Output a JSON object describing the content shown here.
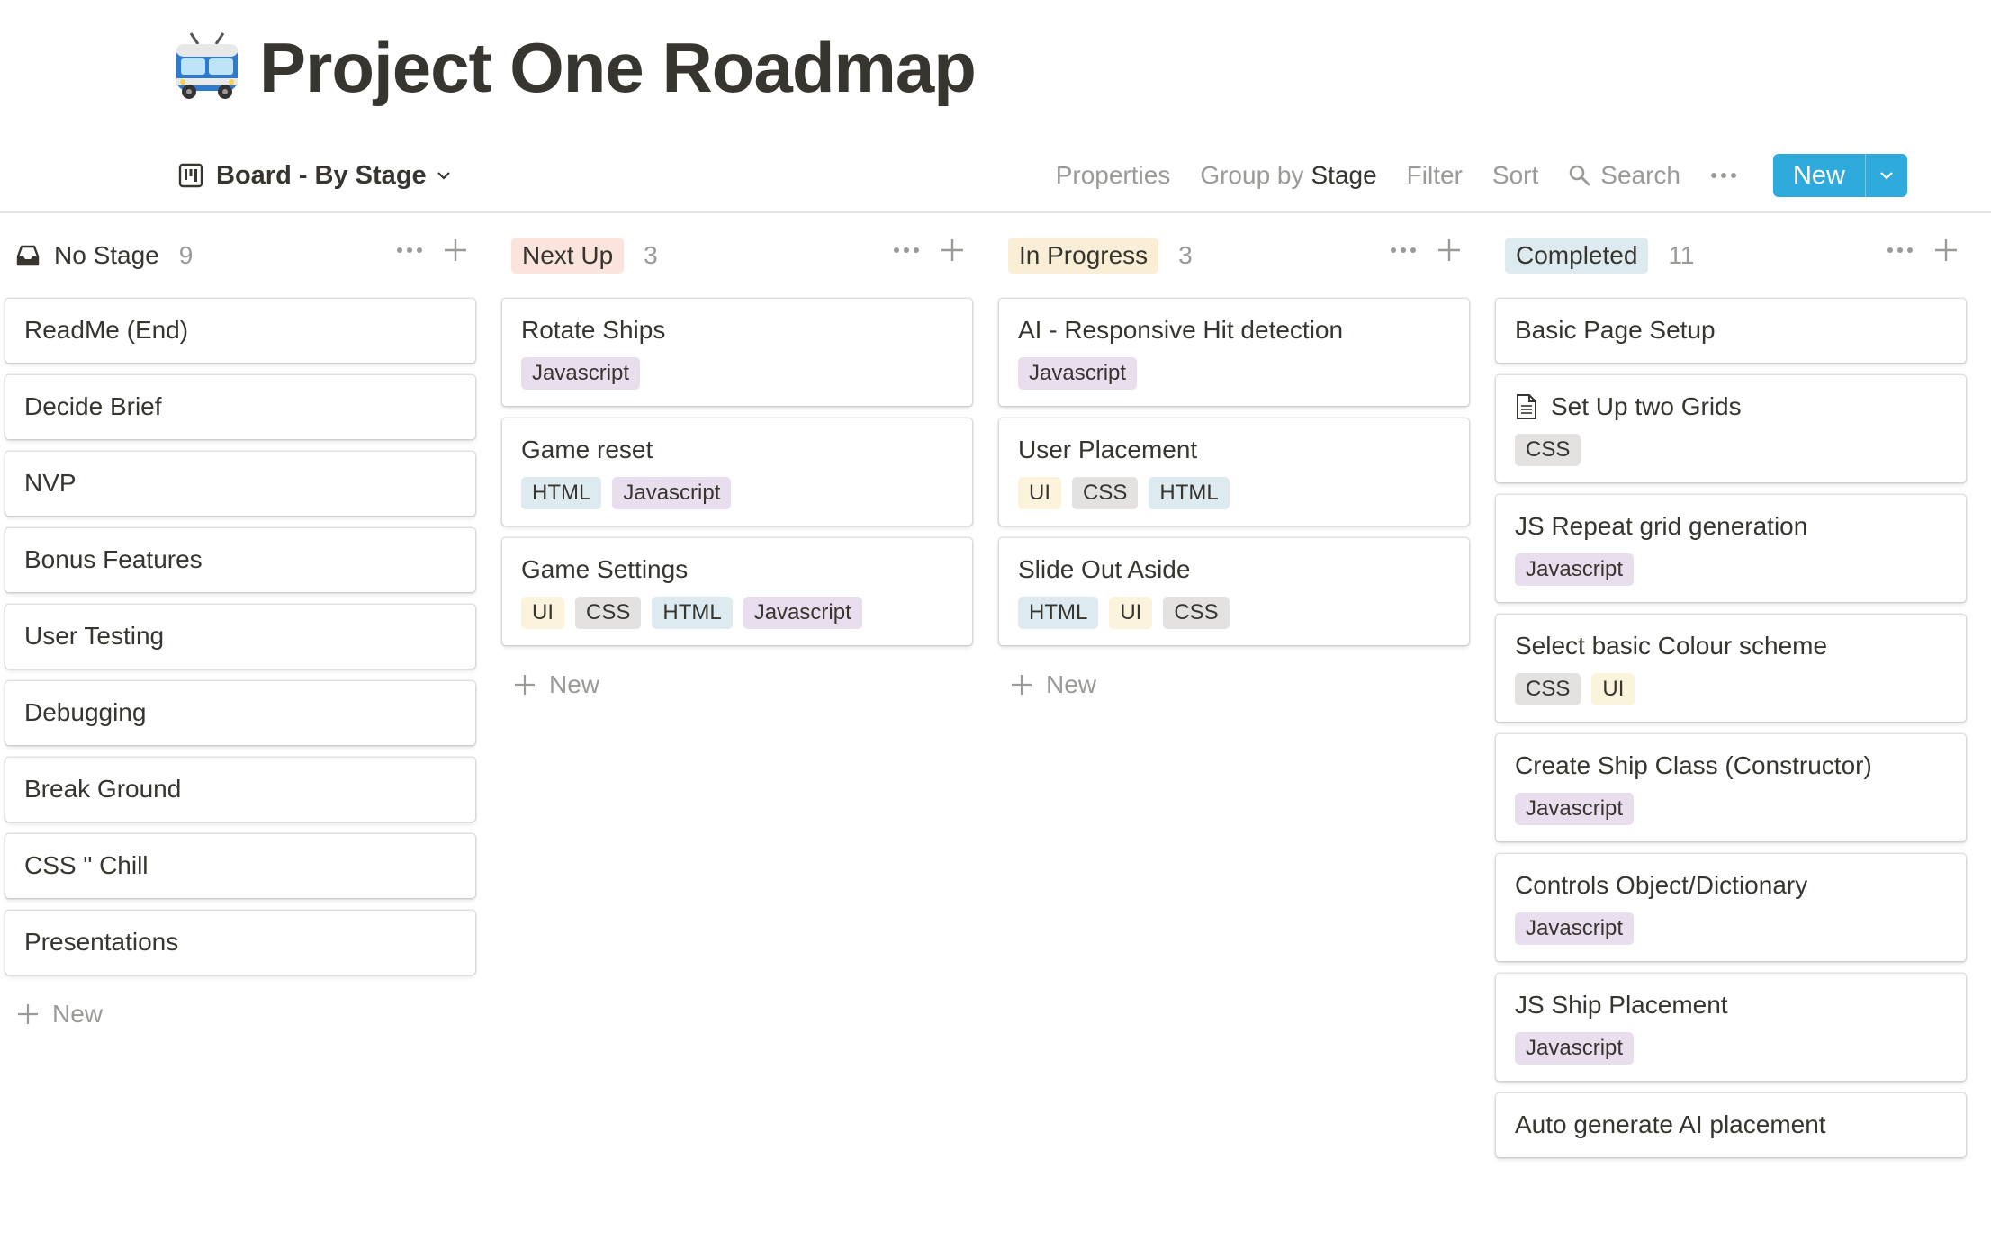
{
  "page": {
    "title": "Project One Roadmap",
    "icon": "trolleybus-emoji"
  },
  "toolbar": {
    "view_name": "Board - By Stage",
    "properties": "Properties",
    "group_by_label": "Group by",
    "group_by_value": "Stage",
    "filter": "Filter",
    "sort": "Sort",
    "search": "Search",
    "new_label": "New"
  },
  "tag_colors": {
    "Javascript": "#e8deee",
    "HTML": "#ddebf1",
    "CSS": "#e3e2e0",
    "UI": "#fbf3db"
  },
  "columns": [
    {
      "name": "No Stage",
      "count": "9",
      "color": "",
      "icon": "inbox-icon",
      "cards": [
        {
          "title": "ReadMe (End)",
          "tags": []
        },
        {
          "title": "Decide Brief",
          "tags": []
        },
        {
          "title": "NVP",
          "tags": []
        },
        {
          "title": "Bonus Features",
          "tags": []
        },
        {
          "title": "User Testing",
          "tags": []
        },
        {
          "title": "Debugging",
          "tags": []
        },
        {
          "title": "Break Ground",
          "tags": []
        },
        {
          "title": "CSS \" Chill",
          "tags": []
        },
        {
          "title": "Presentations",
          "tags": []
        }
      ],
      "add_label": "New"
    },
    {
      "name": "Next Up",
      "count": "3",
      "color": "#fbe4dc",
      "cards": [
        {
          "title": "Rotate Ships",
          "tags": [
            "Javascript"
          ]
        },
        {
          "title": "Game reset",
          "tags": [
            "HTML",
            "Javascript"
          ]
        },
        {
          "title": "Game Settings",
          "tags": [
            "UI",
            "CSS",
            "HTML",
            "Javascript"
          ]
        }
      ],
      "add_label": "New"
    },
    {
      "name": "In Progress",
      "count": "3",
      "color": "#fbeed6",
      "cards": [
        {
          "title": "AI - Responsive Hit detection",
          "tags": [
            "Javascript"
          ]
        },
        {
          "title": "User Placement",
          "tags": [
            "UI",
            "CSS",
            "HTML"
          ]
        },
        {
          "title": "Slide Out Aside",
          "tags": [
            "HTML",
            "UI",
            "CSS"
          ]
        }
      ],
      "add_label": "New"
    },
    {
      "name": "Completed",
      "count": "11",
      "color": "#ddebf1",
      "cards": [
        {
          "title": "Basic Page Setup",
          "tags": []
        },
        {
          "title": "Set Up two Grids",
          "tags": [
            "CSS"
          ],
          "doc_icon": true
        },
        {
          "title": "JS Repeat grid generation",
          "tags": [
            "Javascript"
          ]
        },
        {
          "title": "Select basic Colour scheme",
          "tags": [
            "CSS",
            "UI"
          ]
        },
        {
          "title": "Create Ship Class (Constructor)",
          "tags": [
            "Javascript"
          ]
        },
        {
          "title": "Controls Object/Dictionary",
          "tags": [
            "Javascript"
          ]
        },
        {
          "title": "JS Ship Placement",
          "tags": [
            "Javascript"
          ]
        },
        {
          "title": "Auto generate AI placement",
          "tags": []
        }
      ]
    }
  ]
}
